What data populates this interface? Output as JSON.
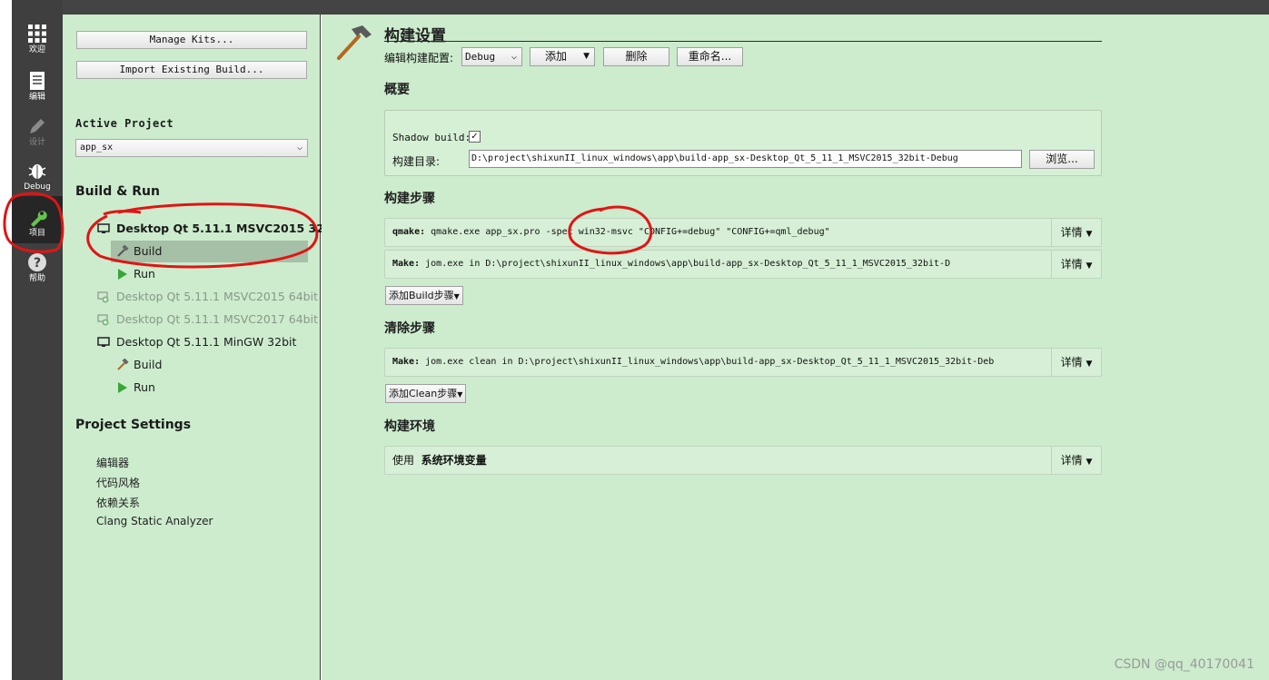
{
  "mode_bar": {
    "items": [
      {
        "label": "欢迎",
        "icon": "grid-icon"
      },
      {
        "label": "编辑",
        "icon": "document-icon"
      },
      {
        "label": "设计",
        "icon": "pencil-icon"
      },
      {
        "label": "Debug",
        "icon": "bug-icon"
      },
      {
        "label": "项目",
        "icon": "wrench-icon"
      },
      {
        "label": "帮助",
        "icon": "help-icon"
      }
    ]
  },
  "sidebar": {
    "manage_kits": "Manage Kits...",
    "import_build": "Import Existing Build...",
    "active_project_title": "Active Project",
    "active_project_value": "app_sx",
    "build_run_title": "Build & Run",
    "kits": [
      {
        "label": "Desktop Qt 5.11.1 MSVC2015 32...",
        "build": "Build",
        "run": "Run"
      },
      {
        "label": "Desktop Qt 5.11.1 MSVC2015 64bit"
      },
      {
        "label": "Desktop Qt 5.11.1 MSVC2017 64bit"
      },
      {
        "label": "Desktop Qt 5.11.1 MinGW 32bit",
        "build": "Build",
        "run": "Run"
      }
    ],
    "project_settings_title": "Project Settings",
    "project_settings": [
      "编辑器",
      "代码风格",
      "依赖关系",
      "Clang Static Analyzer"
    ]
  },
  "main": {
    "title": "构建设置",
    "edit_config_label": "编辑构建配置:",
    "config_value": "Debug",
    "add_label": "添加",
    "delete_label": "删除",
    "rename_label": "重命名...",
    "overview_title": "概要",
    "shadow_build_label": "Shadow build:",
    "shadow_build_checked": "✓",
    "build_dir_label": "构建目录:",
    "build_dir_value": "D:\\project\\shixunII_linux_windows\\app\\build-app_sx-Desktop_Qt_5_11_1_MSVC2015_32bit-Debug",
    "browse_label": "浏览...",
    "build_steps_title": "构建步骤",
    "build_steps": [
      {
        "key": "qmake:",
        "text": " qmake.exe app_sx.pro -spec win32-msvc \"CONFIG+=debug\" \"CONFIG+=qml_debug\"",
        "detail": "详情"
      },
      {
        "key": "Make:",
        "text": " jom.exe in D:\\project\\shixunII_linux_windows\\app\\build-app_sx-Desktop_Qt_5_11_1_MSVC2015_32bit-D",
        "detail": "详情"
      }
    ],
    "add_build_step": "添加Build步骤",
    "clean_steps_title": "清除步骤",
    "clean_steps": [
      {
        "key": "Make:",
        "text": " jom.exe clean in D:\\project\\shixunII_linux_windows\\app\\build-app_sx-Desktop_Qt_5_11_1_MSVC2015_32bit-Deb",
        "detail": "详情"
      }
    ],
    "add_clean_step": "添加Clean步骤",
    "build_env_title": "构建环境",
    "env_use": "使用",
    "env_value": "系统环境变量",
    "env_detail": "详情"
  },
  "watermark": "CSDN @qq_40170041",
  "colors": {
    "panel_bg": "#cceccd",
    "mode_bar": "#3f3f3f",
    "selection": "#a6bfa7",
    "annotation": "#e01515"
  }
}
